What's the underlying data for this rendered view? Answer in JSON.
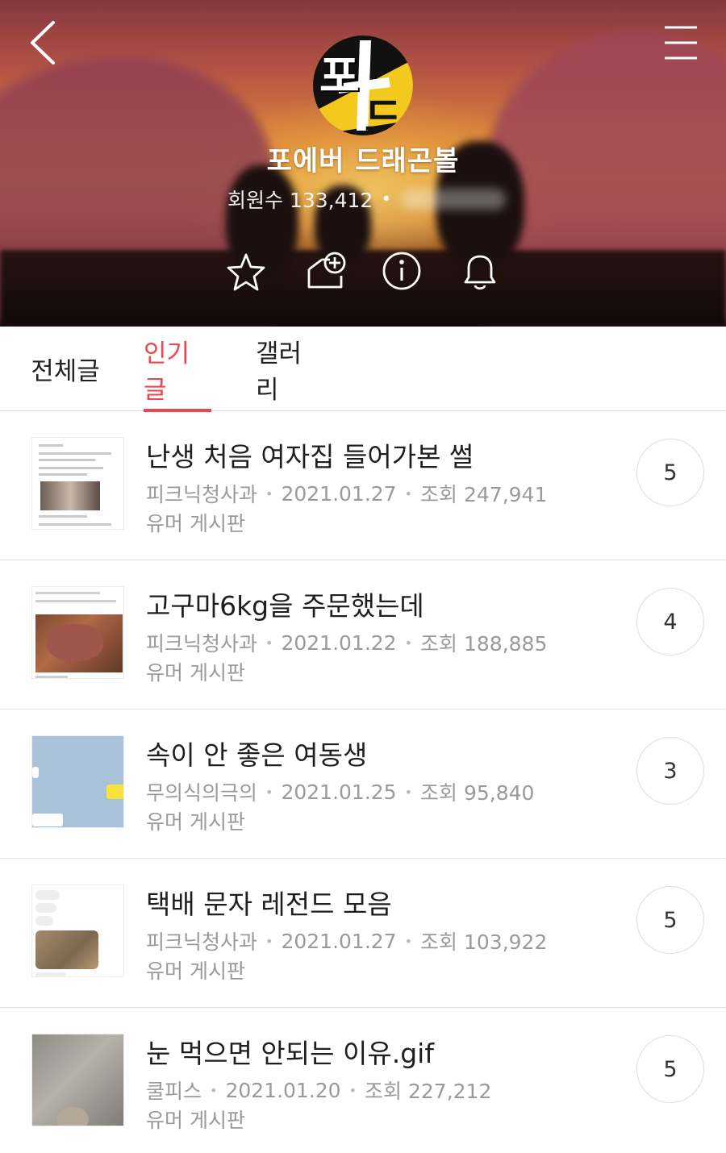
{
  "header": {
    "cafe_name": "포에버 드래곤볼",
    "member_label": "회원수 133,412",
    "member_dot": "•",
    "logo_text_top": "포",
    "logo_text_bottom": "드",
    "icons": {
      "back": "chevron-left-icon",
      "menu": "hamburger-menu-icon",
      "favorite": "star-icon",
      "share": "add-to-home-icon",
      "info": "info-icon",
      "notify": "bell-icon"
    }
  },
  "tabs": [
    {
      "label": "전체글",
      "active": false
    },
    {
      "label": "인기글",
      "active": true
    },
    {
      "label": "갤러리",
      "active": false
    }
  ],
  "accent_color": "#e8484e",
  "posts": [
    {
      "title": "난생 처음 여자집 들어가본 썰",
      "author": "피크닉청사과",
      "date": "2021.01.27",
      "views": "조회 247,941",
      "board": "유머 게시판",
      "comments": "5"
    },
    {
      "title": "고구마6kg을 주문했는데",
      "author": "피크닉청사과",
      "date": "2021.01.22",
      "views": "조회 188,885",
      "board": "유머 게시판",
      "comments": "4"
    },
    {
      "title": "속이 안 좋은 여동생",
      "author": "무의식의극의",
      "date": "2021.01.25",
      "views": "조회 95,840",
      "board": "유머 게시판",
      "comments": "3"
    },
    {
      "title": "택배 문자 레전드 모음",
      "author": "피크닉청사과",
      "date": "2021.01.27",
      "views": "조회 103,922",
      "board": "유머 게시판",
      "comments": "5"
    },
    {
      "title": "눈 먹으면 안되는 이유.gif",
      "author": "쿨피스",
      "date": "2021.01.20",
      "views": "조회 227,212",
      "board": "유머 게시판",
      "comments": "5"
    }
  ]
}
